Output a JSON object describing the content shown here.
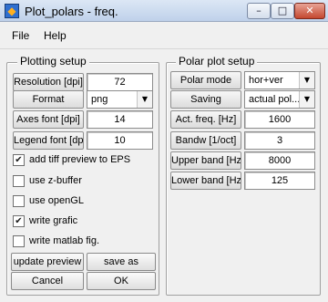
{
  "window": {
    "title": "Plot_polars - freq.",
    "app_icon": "matlab-logo-icon",
    "minimize_glyph": "–",
    "maximize_glyph": "□",
    "close_glyph": "✕"
  },
  "menu": [
    {
      "label": "File"
    },
    {
      "label": "Help"
    }
  ],
  "plotting_setup": {
    "title": "Plotting setup",
    "fields": [
      {
        "label": "Resolution [dpi]",
        "value": "72"
      },
      {
        "label": "Format",
        "value": "png",
        "type": "select"
      },
      {
        "label": "Axes font [dpi]",
        "value": "14"
      },
      {
        "label": "Legend font [dp",
        "value": "10"
      }
    ],
    "checkboxes": [
      {
        "label": "add tiff preview to EPS",
        "checked": true
      },
      {
        "label": "use z-buffer",
        "checked": false
      },
      {
        "label": "use openGL",
        "checked": false
      },
      {
        "label": "write grafic",
        "checked": true
      },
      {
        "label": "write matlab fig.",
        "checked": false
      }
    ],
    "buttons": {
      "update_preview": "update preview",
      "save_as": "save as",
      "cancel": "Cancel",
      "ok": "OK"
    }
  },
  "polar_setup": {
    "title": "Polar plot setup",
    "fields": [
      {
        "label": "Polar mode",
        "value": "hor+ver",
        "type": "select"
      },
      {
        "label": "Saving",
        "value": "actual pol...",
        "type": "select"
      },
      {
        "label": "Act. freq. [Hz]",
        "value": "1600"
      },
      {
        "label": "Bandw [1/oct]",
        "value": "3"
      },
      {
        "label": "Upper band [Hz",
        "value": "8000"
      },
      {
        "label": "Lower band [Hz",
        "value": "125"
      }
    ]
  },
  "icons": {
    "dropdown": "▼",
    "check": "✔"
  }
}
